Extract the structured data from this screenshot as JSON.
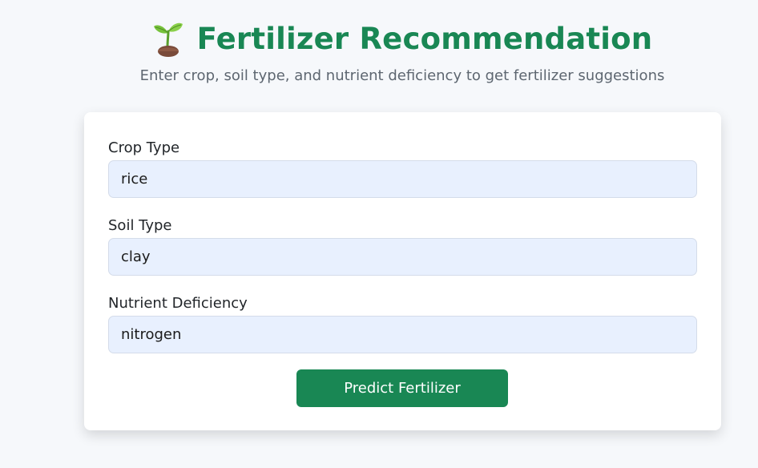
{
  "header": {
    "icon": "sprout-icon",
    "title": "Fertilizer Recommendation",
    "subtitle": "Enter crop, soil type, and nutrient deficiency to get fertilizer suggestions"
  },
  "form": {
    "crop": {
      "label": "Crop Type",
      "value": "rice"
    },
    "soil": {
      "label": "Soil Type",
      "value": "clay"
    },
    "nutrient": {
      "label": "Nutrient Deficiency",
      "value": "nitrogen"
    },
    "submit_label": "Predict Fertilizer"
  },
  "colors": {
    "accent": "#198754",
    "input_bg": "#e8f0fe",
    "page_bg": "#f6f8fb"
  }
}
